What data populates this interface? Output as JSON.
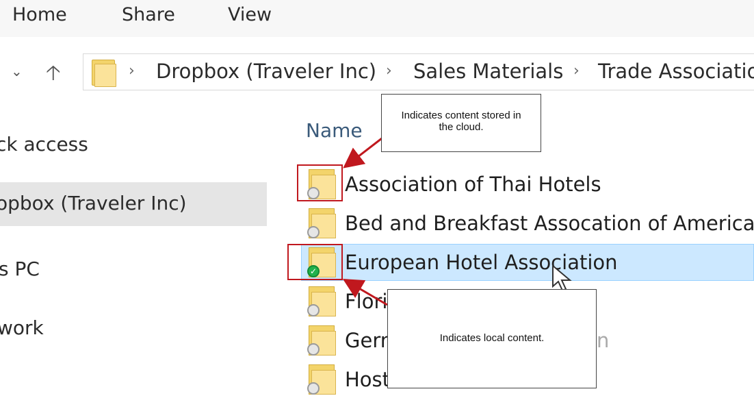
{
  "ribbon": {
    "tabs": [
      "Home",
      "Share",
      "View"
    ]
  },
  "address_bar": {
    "breadcrumbs": [
      "Dropbox (Traveler Inc)",
      "Sales Materials",
      "Trade Associatio"
    ]
  },
  "nav_pane": {
    "items": [
      "ck access",
      "opbox (Traveler Inc)",
      "s PC",
      "work"
    ],
    "selected_index": 1
  },
  "file_list": {
    "column_header": "Name",
    "rows": [
      {
        "name": "Association of Thai Hotels",
        "status": "cloud"
      },
      {
        "name": "Bed and Breakfast Assocation of America",
        "status": "cloud"
      },
      {
        "name": "European Hotel Association",
        "status": "local",
        "selected": true
      },
      {
        "name": "Flori",
        "status": "cloud"
      },
      {
        "name": "Gern",
        "status": "cloud"
      },
      {
        "name": "Host",
        "status": "cloud"
      }
    ]
  },
  "callouts": {
    "cloud": {
      "line1": "Indicates content stored in",
      "line2": "the cloud."
    },
    "local": {
      "text": "Indicates local content.",
      "trail": "n"
    }
  },
  "colors": {
    "annotation_red": "#c0181e",
    "selection_blue": "#cce8ff",
    "folder_yellow": "#fbe39a",
    "synced_green": "#22b14c"
  },
  "icons": {
    "back": "chevron-down-icon",
    "up": "up-arrow-icon",
    "sync_cloud": "cloud-status-icon",
    "sync_local": "checkmark-status-icon"
  }
}
